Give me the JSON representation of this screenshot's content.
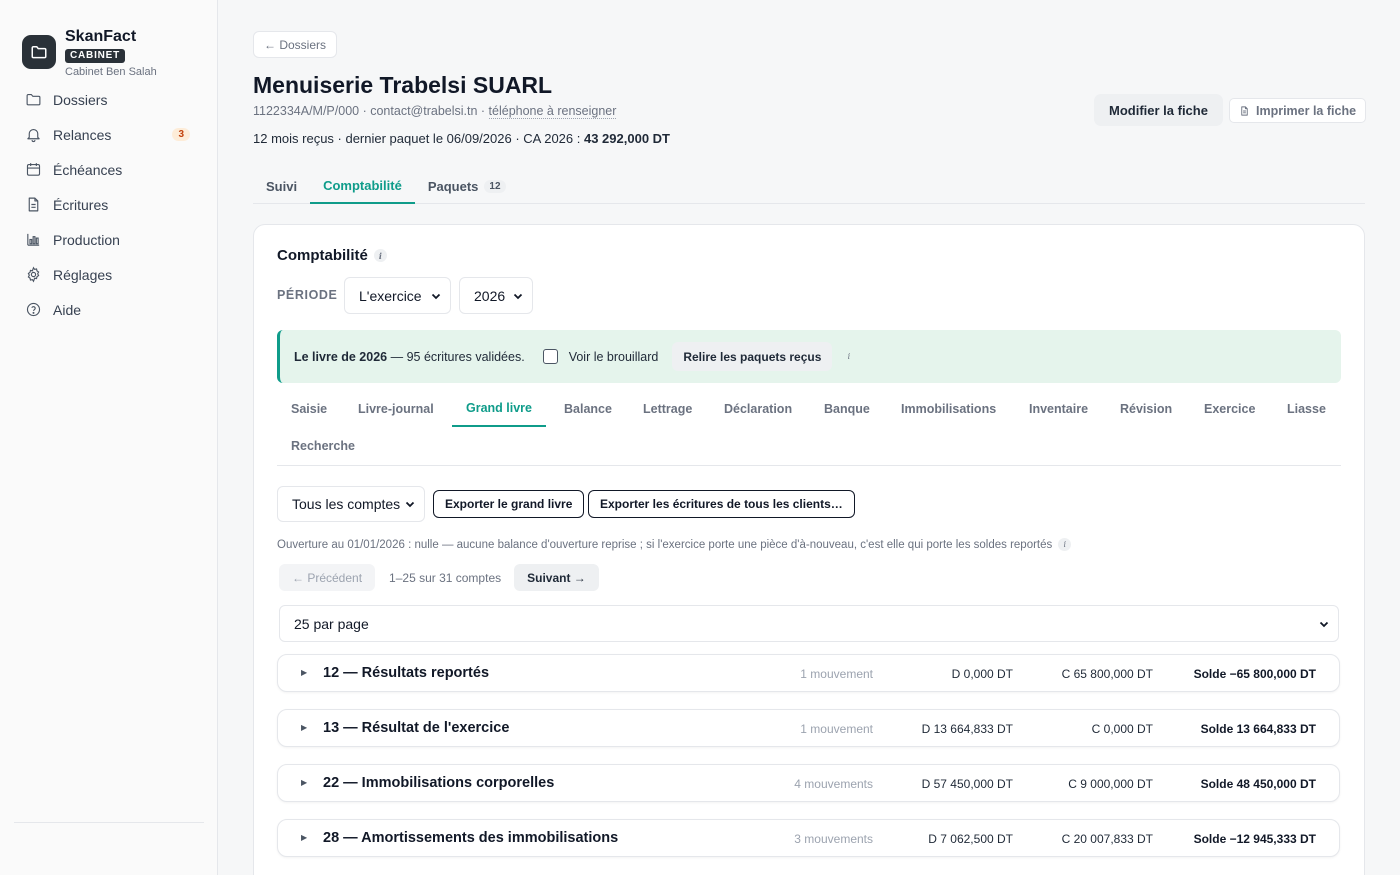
{
  "brand": {
    "name": "SkanFact",
    "badge": "CABINET",
    "subtitle": "Cabinet Ben Salah"
  },
  "sidebar": {
    "items": [
      {
        "label": "Dossiers",
        "icon": "folder-icon"
      },
      {
        "label": "Relances",
        "icon": "bell-icon",
        "badge": "3"
      },
      {
        "label": "Échéances",
        "icon": "calendar-icon"
      },
      {
        "label": "Écritures",
        "icon": "document-icon"
      },
      {
        "label": "Production",
        "icon": "bar-chart-icon"
      },
      {
        "label": "Réglages",
        "icon": "gear-icon"
      },
      {
        "label": "Aide",
        "icon": "help-icon"
      }
    ]
  },
  "header": {
    "back_label": "← Dossiers",
    "title": "Menuiserie Trabelsi SUARL",
    "tax_id": "1122334A/M/P/000",
    "email": "contact@trabelsi.tn",
    "phone": "téléphone à renseigner",
    "summary_prefix": "12 mois reçus · dernier paquet le 06/09/2026 · CA 2026 : ",
    "summary_amount": "43 292,000 DT",
    "edit_label": "Modifier la fiche",
    "print_label": "Imprimer la fiche"
  },
  "tabs": [
    {
      "label": "Suivi"
    },
    {
      "label": "Comptabilité",
      "active": true
    },
    {
      "label": "Paquets",
      "count": "12"
    }
  ],
  "card": {
    "title": "Comptabilité",
    "info": "i",
    "period_label": "PÉRIODE",
    "period_value": "L'exercice",
    "year_value": "2026"
  },
  "banner": {
    "bold": "Le livre de 2026",
    "rest": " — 95 écritures validées.",
    "checkbox_label": "Voir le brouillard",
    "button_label": "Relire les paquets reçus",
    "info": "i"
  },
  "subtabs": [
    {
      "label": "Saisie"
    },
    {
      "label": "Livre-journal"
    },
    {
      "label": "Grand livre",
      "active": true
    },
    {
      "label": "Balance"
    },
    {
      "label": "Lettrage"
    },
    {
      "label": "Déclaration"
    },
    {
      "label": "Banque"
    },
    {
      "label": "Immobilisations"
    },
    {
      "label": "Inventaire"
    },
    {
      "label": "Révision"
    },
    {
      "label": "Exercice"
    },
    {
      "label": "Liasse"
    },
    {
      "label": "Recherche"
    }
  ],
  "toolbar": {
    "accounts_select": "Tous les comptes",
    "export_ledger": "Exporter le grand livre",
    "export_all": "Exporter les écritures de tous les clients…"
  },
  "opening_note": "Ouverture au 01/01/2026 : nulle — aucune balance d'ouverture reprise ; si l'exercice porte une pièce d'à-nouveau, c'est elle qui porte les soldes reportés",
  "pager": {
    "prev": "← Précédent",
    "info": "1–25 sur 31 comptes",
    "next": "Suivant →"
  },
  "per_page": "25 par page",
  "accounts": [
    {
      "name": "12 — Résultats reportés",
      "movements": "1 mouvement",
      "debit": "D 0,000 DT",
      "credit": "C 65 800,000 DT",
      "balance": "Solde −65 800,000 DT"
    },
    {
      "name": "13 — Résultat de l'exercice",
      "movements": "1 mouvement",
      "debit": "D 13 664,833 DT",
      "credit": "C 0,000 DT",
      "balance": "Solde 13 664,833 DT"
    },
    {
      "name": "22 — Immobilisations corporelles",
      "movements": "4 mouvements",
      "debit": "D 57 450,000 DT",
      "credit": "C 9 000,000 DT",
      "balance": "Solde 48 450,000 DT"
    },
    {
      "name": "28 — Amortissements des immobilisations",
      "movements": "3 mouvements",
      "debit": "D 7 062,500 DT",
      "credit": "C 20 007,833 DT",
      "balance": "Solde −12 945,333 DT"
    }
  ],
  "colors": {
    "accent": "#0f9c8a",
    "dark": "#2a3138",
    "banner_bg": "#e5f4ec",
    "badge_bg": "#fdecd8",
    "badge_fg": "#c2410c"
  }
}
